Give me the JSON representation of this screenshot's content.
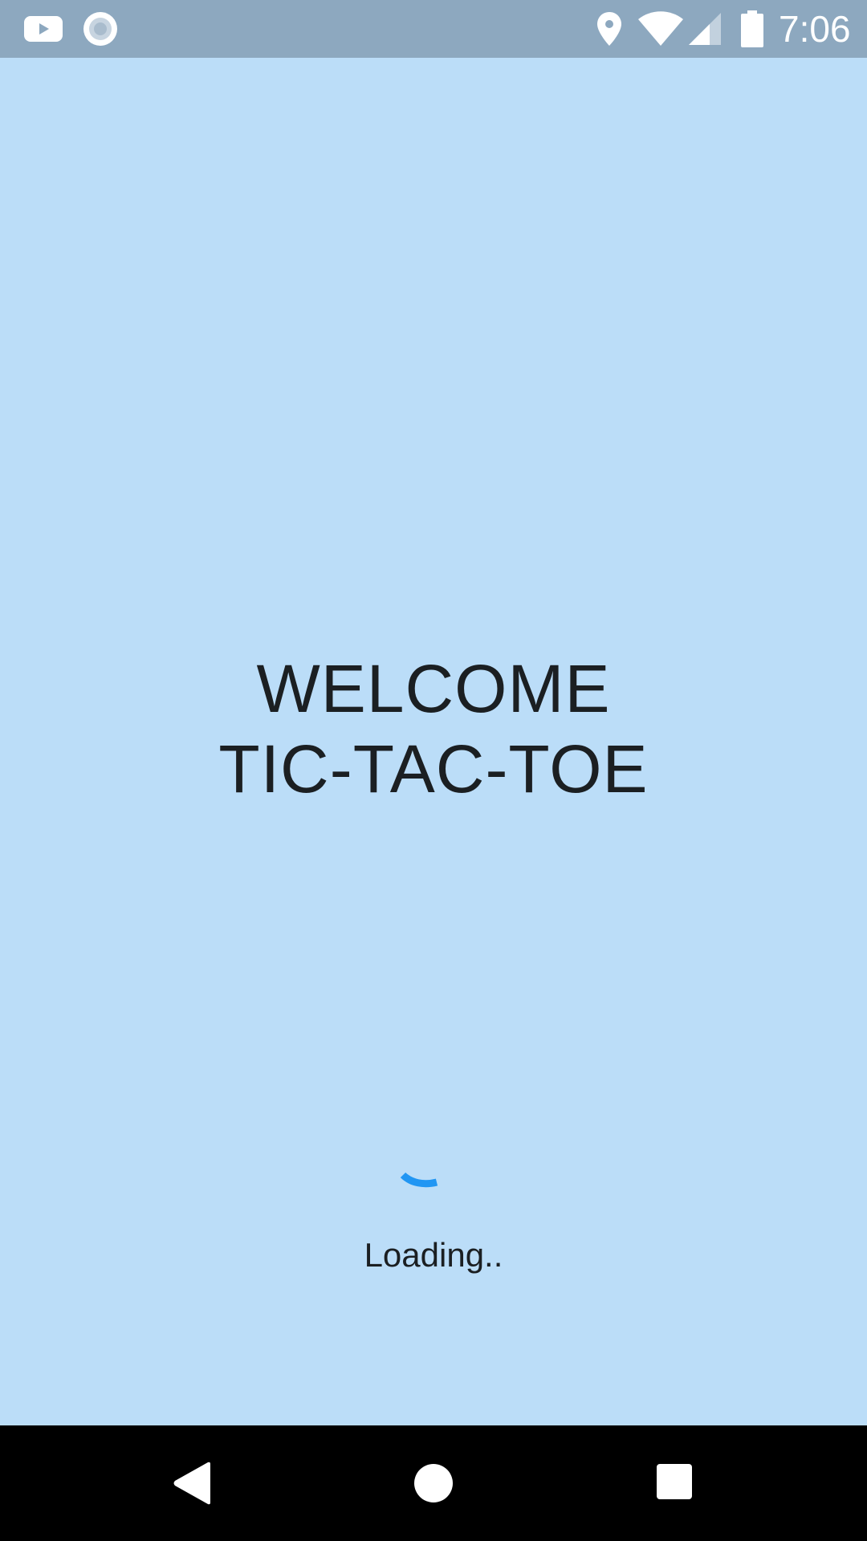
{
  "status_bar": {
    "time": "7:06",
    "icons": [
      "youtube-icon",
      "radio-icon",
      "location-icon",
      "wifi-icon",
      "signal-icon",
      "battery-icon"
    ]
  },
  "welcome": {
    "line1": "WELCOME",
    "line2": "TIC-TAC-TOE"
  },
  "loading": {
    "text": "Loading..",
    "spinner_color": "#2196f3"
  },
  "nav_bar": {
    "buttons": [
      "back-icon",
      "home-icon",
      "recents-icon"
    ]
  },
  "colors": {
    "background": "#bbddf8",
    "status_bar": "#8da8bf",
    "text": "#1b1f22",
    "nav_bar": "#000000"
  }
}
